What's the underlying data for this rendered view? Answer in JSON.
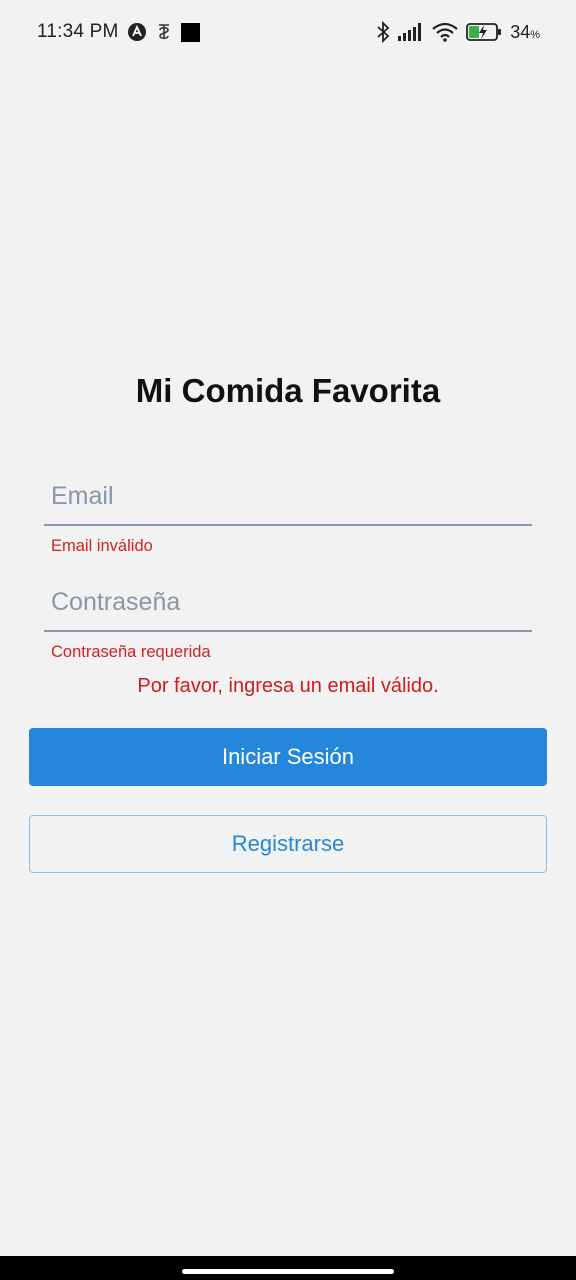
{
  "status_bar": {
    "time": "11:34 PM",
    "battery_percent": "34",
    "battery_unit": "%",
    "icons_left": [
      "app-a-icon",
      "notification-icon",
      "square-icon"
    ],
    "icons_right": [
      "bluetooth-icon",
      "signal-icon",
      "wifi-icon",
      "battery-charging-icon"
    ]
  },
  "login": {
    "title": "Mi Comida Favorita",
    "email": {
      "value": "",
      "placeholder": "Email",
      "error": "Email inválido"
    },
    "password": {
      "value": "",
      "placeholder": "Contraseña",
      "error": "Contraseña requerida"
    },
    "form_error": "Por favor, ingresa un email válido.",
    "login_button": "Iniciar Sesión",
    "register_button": "Registrarse"
  },
  "colors": {
    "background": "#f2f2f2",
    "primary": "#2487dc",
    "error": "#d32222",
    "input_underline": "#8a9aab"
  }
}
